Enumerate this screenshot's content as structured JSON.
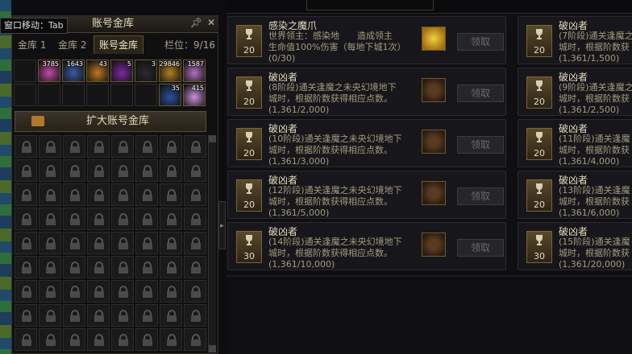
{
  "window": {
    "move_label": "窗口移动：Tab",
    "title": "账号金库",
    "pin_icon": "pin-icon",
    "close_icon": "close-icon"
  },
  "tabs": [
    {
      "label": "金库 1",
      "active": false
    },
    {
      "label": "金库 2",
      "active": false
    },
    {
      "label": "账号金库",
      "active": true
    }
  ],
  "slot_info": "栏位：9/16",
  "items": [
    {
      "name": "pink-orb",
      "qty": "3785",
      "color": "#c24aa8"
    },
    {
      "name": "winged-crystal",
      "qty": "1643",
      "color": "#3a5aa0"
    },
    {
      "name": "gold-burst",
      "qty": "43",
      "color": "#c07820"
    },
    {
      "name": "purple-gem",
      "qty": "5",
      "color": "#7a2aa0"
    },
    {
      "name": "dark-box",
      "qty": "3",
      "color": "#2a2a30"
    },
    {
      "name": "gold-ticket",
      "qty": "29846",
      "color": "#b08020"
    },
    {
      "name": "lavender-scroll",
      "qty": "1587",
      "color": "#b070c0"
    },
    {
      "name": "blue-shard",
      "qty": "35",
      "color": "#2a50a0"
    },
    {
      "name": "pink-flower",
      "qty": "415",
      "color": "#c890d8"
    }
  ],
  "expand_label": "扩大账号金库",
  "achievements": [
    {
      "title": "感染之魔爪",
      "desc1": "世界领主：感染地　　造成领主",
      "desc2": "生命值100%伤害（每地下城1次）",
      "progress": "(0/30)",
      "points": "20",
      "reward": "gold-star-icon",
      "claim": "领取"
    },
    {
      "title": "破凶者",
      "desc1": "(8阶段)通关逢魔之未央幻境地下",
      "desc2": "城时，根据阶数获得相应点数。",
      "progress": "(1,361/2,000)",
      "points": "20",
      "reward": "tower-icon",
      "claim": "领取"
    },
    {
      "title": "破凶者",
      "desc1": "(10阶段)通关逢魔之未央幻境地下",
      "desc2": "城时，根据阶数获得相应点数。",
      "progress": "(1,361/3,000)",
      "points": "20",
      "reward": "tower-icon",
      "claim": "领取"
    },
    {
      "title": "破凶者",
      "desc1": "(12阶段)通关逢魔之未央幻境地下",
      "desc2": "城时，根据阶数获得相应点数。",
      "progress": "(1,361/5,000)",
      "points": "20",
      "reward": "tower-icon",
      "claim": "领取"
    },
    {
      "title": "破凶者",
      "desc1": "(14阶段)通关逢魔之未央幻境地下",
      "desc2": "城时，根据阶数获得相应点数。",
      "progress": "(1,361/10,000)",
      "points": "30",
      "reward": "tower-icon",
      "claim": "领取"
    }
  ],
  "achievements_right": [
    {
      "title": "破凶者",
      "desc1": "(7阶段)通关逢魔之",
      "desc2": "城时，根据阶数获",
      "progress": "(1,361/1,500)",
      "points": "20"
    },
    {
      "title": "破凶者",
      "desc1": "(9阶段)通关逢魔之",
      "desc2": "城时，根据阶数获",
      "progress": "(1,361/2,500)",
      "points": "20"
    },
    {
      "title": "破凶者",
      "desc1": "(11阶段)通关逢魔",
      "desc2": "城时，根据阶数获",
      "progress": "(1,361/4,000)",
      "points": "20"
    },
    {
      "title": "破凶者",
      "desc1": "(13阶段)通关逢魔",
      "desc2": "城时，根据阶数获",
      "progress": "(1,361/6,000)",
      "points": "20"
    },
    {
      "title": "破凶者",
      "desc1": "(15阶段)通关逢魔",
      "desc2": "城时，根据阶数获",
      "progress": "(1,361/20,000)",
      "points": "30"
    }
  ]
}
